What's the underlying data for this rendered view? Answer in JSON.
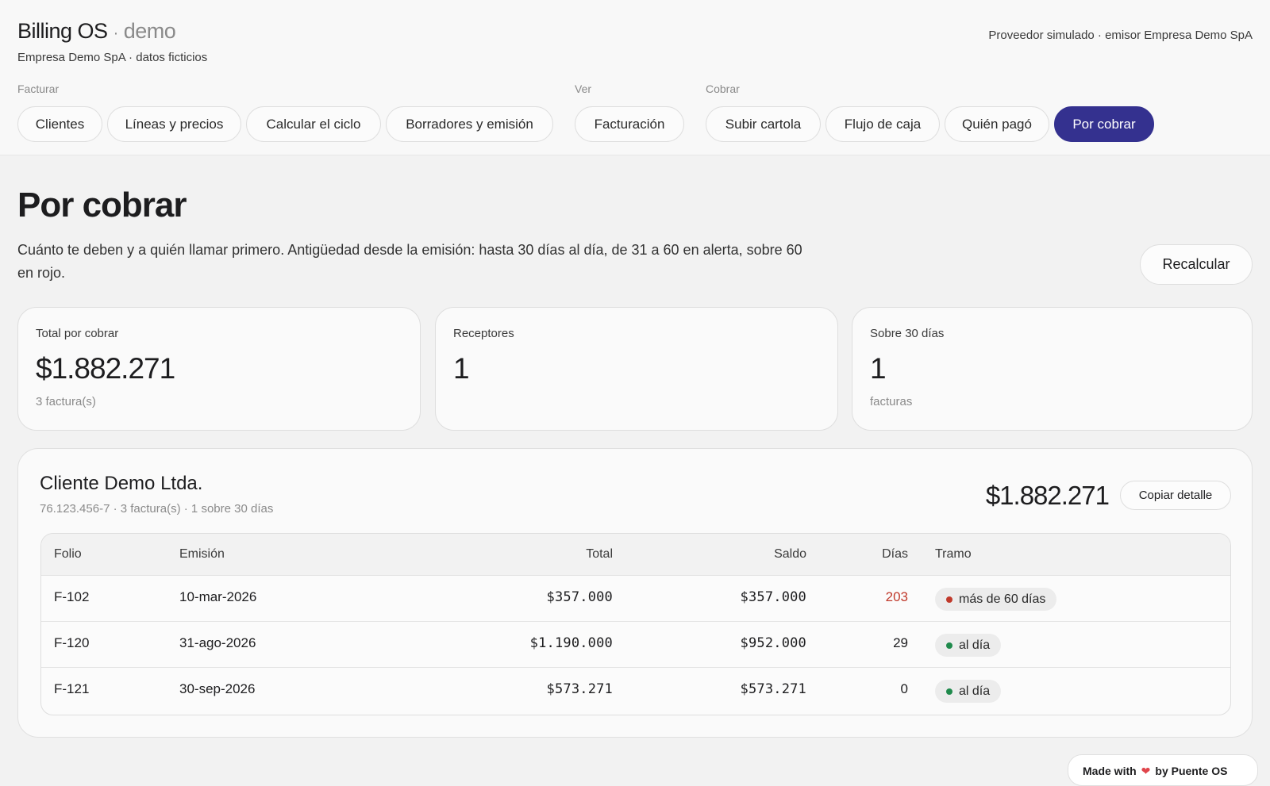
{
  "app": {
    "brand": "Billing OS",
    "brand_sep": "·",
    "brand_suffix": "demo",
    "subtitle": "Empresa Demo SpA · datos ficticios",
    "provider": "Proveedor simulado · emisor Empresa Demo SpA"
  },
  "nav": {
    "groups": [
      {
        "label": "Facturar",
        "items": [
          "Clientes",
          "Líneas y precios",
          "Calcular el ciclo",
          "Borradores y emisión"
        ]
      },
      {
        "label": "Ver",
        "items": [
          "Facturación"
        ]
      },
      {
        "label": "Cobrar",
        "items": [
          "Subir cartola",
          "Flujo de caja",
          "Quién pagó",
          "Por cobrar"
        ]
      }
    ],
    "active": "Por cobrar"
  },
  "page": {
    "title": "Por cobrar",
    "description": "Cuánto te deben y a quién llamar primero. Antigüedad desde la emisión: hasta 30 días al día, de 31 a 60 en alerta, sobre 60 en rojo.",
    "recalc_label": "Recalcular"
  },
  "stats": [
    {
      "label": "Total por cobrar",
      "value": "$1.882.271",
      "note": "3 factura(s)"
    },
    {
      "label": "Receptores",
      "value": "1",
      "note": ""
    },
    {
      "label": "Sobre 30 días",
      "value": "1",
      "note": "facturas"
    }
  ],
  "client": {
    "name": "Cliente Demo Ltda.",
    "meta": "76.123.456-7 · 3 factura(s) · 1 sobre 30 días",
    "total": "$1.882.271",
    "copy_label": "Copiar detalle",
    "columns": [
      "Folio",
      "Emisión",
      "Total",
      "Saldo",
      "Días",
      "Tramo"
    ],
    "rows": [
      {
        "folio": "F-102",
        "emision": "10-mar-2026",
        "total": "$357.000",
        "saldo": "$357.000",
        "dias": "203",
        "tramo": "más de 60 días",
        "status": "red"
      },
      {
        "folio": "F-120",
        "emision": "31-ago-2026",
        "total": "$1.190.000",
        "saldo": "$952.000",
        "dias": "29",
        "tramo": "al día",
        "status": "green"
      },
      {
        "folio": "F-121",
        "emision": "30-sep-2026",
        "total": "$573.271",
        "saldo": "$573.271",
        "dias": "0",
        "tramo": "al día",
        "status": "green"
      }
    ]
  },
  "colors": {
    "accent": "#34318f",
    "red": "#c0392b",
    "green": "#1f8a4c"
  },
  "footer": {
    "made_with": "Made with",
    "by": "by Puente OS"
  }
}
